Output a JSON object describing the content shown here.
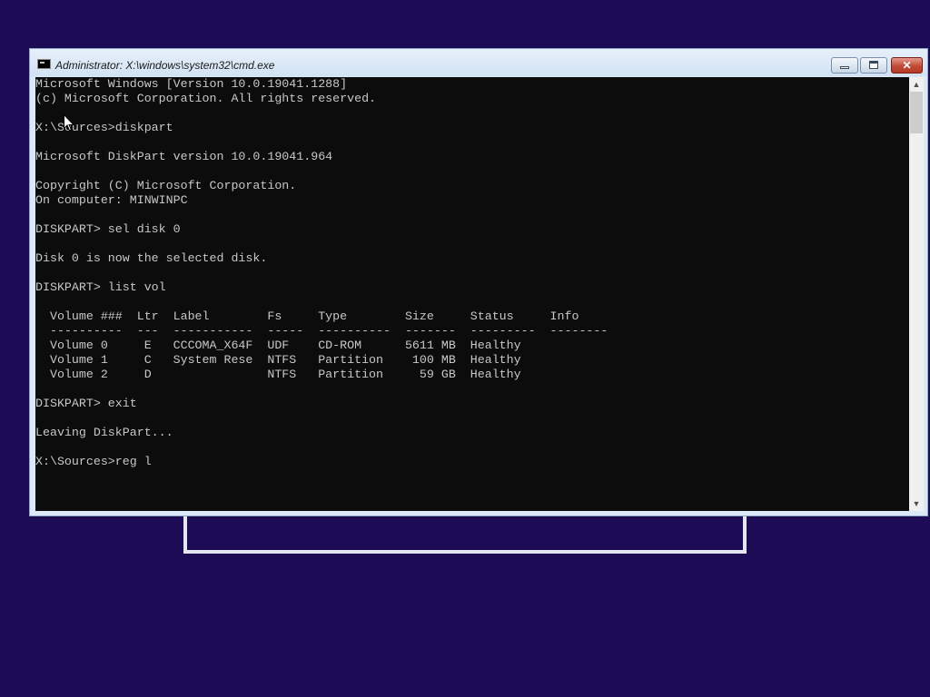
{
  "window": {
    "title": "Administrator: X:\\windows\\system32\\cmd.exe",
    "minimize_icon": "minimize-icon",
    "maximize_icon": "maximize-icon",
    "close_symbol": "✕"
  },
  "console": {
    "lines": [
      "Microsoft Windows [Version 10.0.19041.1288]",
      "(c) Microsoft Corporation. All rights reserved.",
      "",
      "X:\\Sources>diskpart",
      "",
      "Microsoft DiskPart version 10.0.19041.964",
      "",
      "Copyright (C) Microsoft Corporation.",
      "On computer: MINWINPC",
      "",
      "DISKPART> sel disk 0",
      "",
      "Disk 0 is now the selected disk.",
      "",
      "DISKPART> list vol",
      "",
      "  Volume ###  Ltr  Label        Fs     Type        Size     Status     Info",
      "  ----------  ---  -----------  -----  ----------  -------  ---------  --------",
      "  Volume 0     E   CCCOMA_X64F  UDF    CD-ROM      5611 MB  Healthy",
      "  Volume 1     C   System Rese  NTFS   Partition    100 MB  Healthy",
      "  Volume 2     D                NTFS   Partition     59 GB  Healthy",
      "",
      "DISKPART> exit",
      "",
      "Leaving DiskPart...",
      "",
      "X:\\Sources>reg l"
    ]
  },
  "scrollbar": {
    "up_arrow": "▲",
    "down_arrow": "▼"
  },
  "colors": {
    "desktop_background": "#1d0b55",
    "console_background": "#0c0c0c",
    "console_text": "#c8c8c8"
  }
}
